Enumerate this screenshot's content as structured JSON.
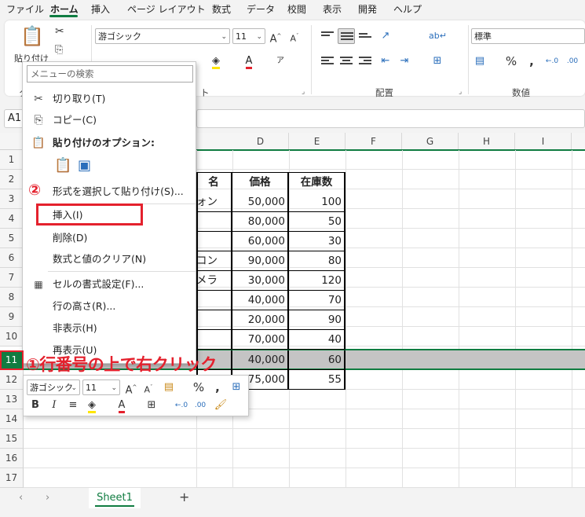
{
  "menu": {
    "items": [
      "ファイル",
      "ホーム",
      "挿入",
      "ページ レイアウト",
      "数式",
      "データ",
      "校閲",
      "表示",
      "開発",
      "ヘルプ"
    ],
    "active": "ホーム"
  },
  "ribbon": {
    "paste_label": "貼り付け",
    "font_name": "游ゴシック",
    "font_size": "11",
    "number_format": "標準",
    "group_alignment": "配置",
    "group_number": "数値",
    "group_font_partial": "ト",
    "group_clip_partial": "ク"
  },
  "formula_bar": {
    "name_box": "A1"
  },
  "columns": [
    "D",
    "E",
    "F",
    "G",
    "H",
    "I"
  ],
  "rows": [
    "1",
    "2",
    "3",
    "4",
    "5",
    "6",
    "7",
    "8",
    "9",
    "10",
    "11",
    "12",
    "13",
    "14",
    "15",
    "16",
    "17"
  ],
  "selected_row": "11",
  "table": {
    "header_partial": "名",
    "col_d_header": "価格",
    "col_e_header": "在庫数",
    "partial_names": [
      "ォン",
      "",
      "",
      "コン",
      "メラ",
      "",
      "",
      "",
      "",
      ""
    ],
    "prices": [
      "50,000",
      "80,000",
      "60,000",
      "90,000",
      "30,000",
      "40,000",
      "20,000",
      "70,000",
      "40,000",
      "75,000"
    ],
    "stock": [
      "100",
      "50",
      "30",
      "80",
      "120",
      "70",
      "90",
      "40",
      "60",
      "55"
    ]
  },
  "context_menu": {
    "search_placeholder": "メニューの検索",
    "cut": "切り取り(T)",
    "copy": "コピー(C)",
    "paste_options": "貼り付けのオプション:",
    "paste_special": "形式を選択して貼り付け(S)...",
    "insert": "挿入(I)",
    "delete": "削除(D)",
    "clear": "数式と値のクリア(N)",
    "format_cells": "セルの書式設定(F)...",
    "row_height": "行の高さ(R)...",
    "hide": "非表示(H)",
    "unhide": "再表示(U)"
  },
  "mini_toolbar": {
    "font_name": "游ゴシック",
    "font_size": "11"
  },
  "sheet_tabs": {
    "active": "Sheet1"
  },
  "annotations": {
    "step1": "①行番号の上で右クリック",
    "step2": "②"
  },
  "colors": {
    "accent": "#107c41",
    "annotation": "#e4212d"
  }
}
